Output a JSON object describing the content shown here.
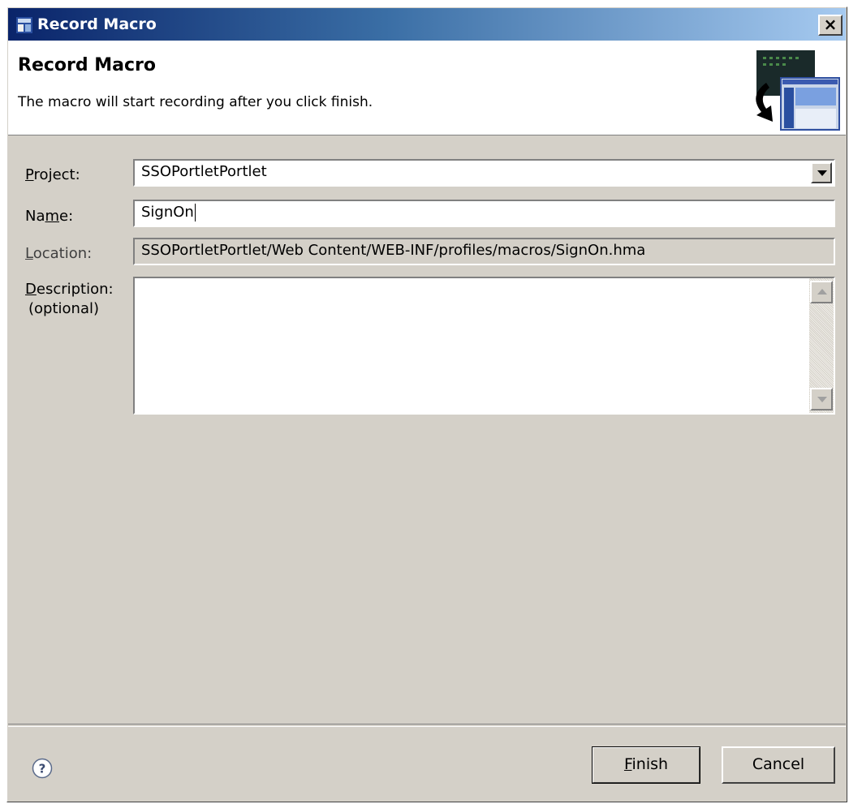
{
  "window": {
    "title": "Record Macro",
    "close_glyph": "×"
  },
  "header": {
    "title": "Record Macro",
    "description": "The macro will start recording after you click finish.",
    "graphic": "macro-record-wizard-icon"
  },
  "form": {
    "project": {
      "label_prefix": "",
      "label_mnemonic": "P",
      "label_rest": "roject:",
      "value": "SSOPortletPortlet"
    },
    "name": {
      "label_prefix": "Na",
      "label_mnemonic": "m",
      "label_rest": "e:",
      "value": "SignOn"
    },
    "location": {
      "label_prefix": "",
      "label_mnemonic": "L",
      "label_rest": "ocation:",
      "value": "SSOPortletPortlet/Web Content/WEB-INF/profiles/macros/SignOn.hma"
    },
    "description": {
      "label_prefix": "",
      "label_mnemonic": "D",
      "label_rest": "escription:",
      "label_line2": "(optional)",
      "value": ""
    }
  },
  "footer": {
    "help_icon": "help-icon",
    "finish_mnemonic": "F",
    "finish_rest": "inish",
    "cancel_label": "Cancel"
  }
}
